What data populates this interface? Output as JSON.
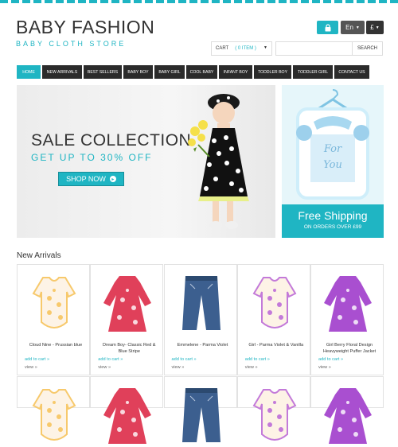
{
  "header": {
    "brand_title": "BABY FASHION",
    "brand_subtitle": "BABY CLOTH STORE",
    "lock_icon": "lock-icon",
    "language": "En",
    "currency": "£"
  },
  "cart": {
    "label": "CART",
    "count": "( 0 ITEM )"
  },
  "search": {
    "placeholder": "",
    "button_label": "SEARCH"
  },
  "nav": {
    "items": [
      {
        "label": "HOME",
        "active": true
      },
      {
        "label": "NEW ARRIVALS"
      },
      {
        "label": "BEST SELLERS"
      },
      {
        "label": "BABY BOY"
      },
      {
        "label": "BABY GIRL"
      },
      {
        "label": "COOL BABY"
      },
      {
        "label": "INFANT BOY"
      },
      {
        "label": "TODDLER BOY"
      },
      {
        "label": "TODDLER GIRL"
      },
      {
        "label": "CONTACT US"
      }
    ]
  },
  "banner": {
    "title": "SALE COLLECTION",
    "subtitle": "GET UP TO 30% OFF",
    "button_label": "SHOP NOW"
  },
  "shipping": {
    "title": "Free Shipping",
    "subtitle": "ON ORDERS OVER £99",
    "frame_text_1": "For",
    "frame_text_2": "You"
  },
  "new_arrivals": {
    "title": "New Arrivals",
    "add_to_cart_label": "add to cart »",
    "view_label": "view »",
    "products": [
      {
        "name": "Cloud Nine - Prussian blue",
        "type": "bodysuit",
        "color": "#f7c96c"
      },
      {
        "name": "Dream Boy- Classic Red & Blue Stripe",
        "type": "dress",
        "color": "#e0405a"
      },
      {
        "name": "Emmelene - Parma Violet",
        "type": "jeans",
        "color": "#3c5f8f"
      },
      {
        "name": "Girl - Parma Violet & Vanilla",
        "type": "bodysuit",
        "color": "#c37ad9"
      },
      {
        "name": "Girl Berry Floral Design Heavyweight Puffer Jacket",
        "type": "dress",
        "color": "#a94fd0"
      }
    ]
  },
  "colors": {
    "accent": "#1fb5c3",
    "nav_bg": "#2b2b2b"
  }
}
